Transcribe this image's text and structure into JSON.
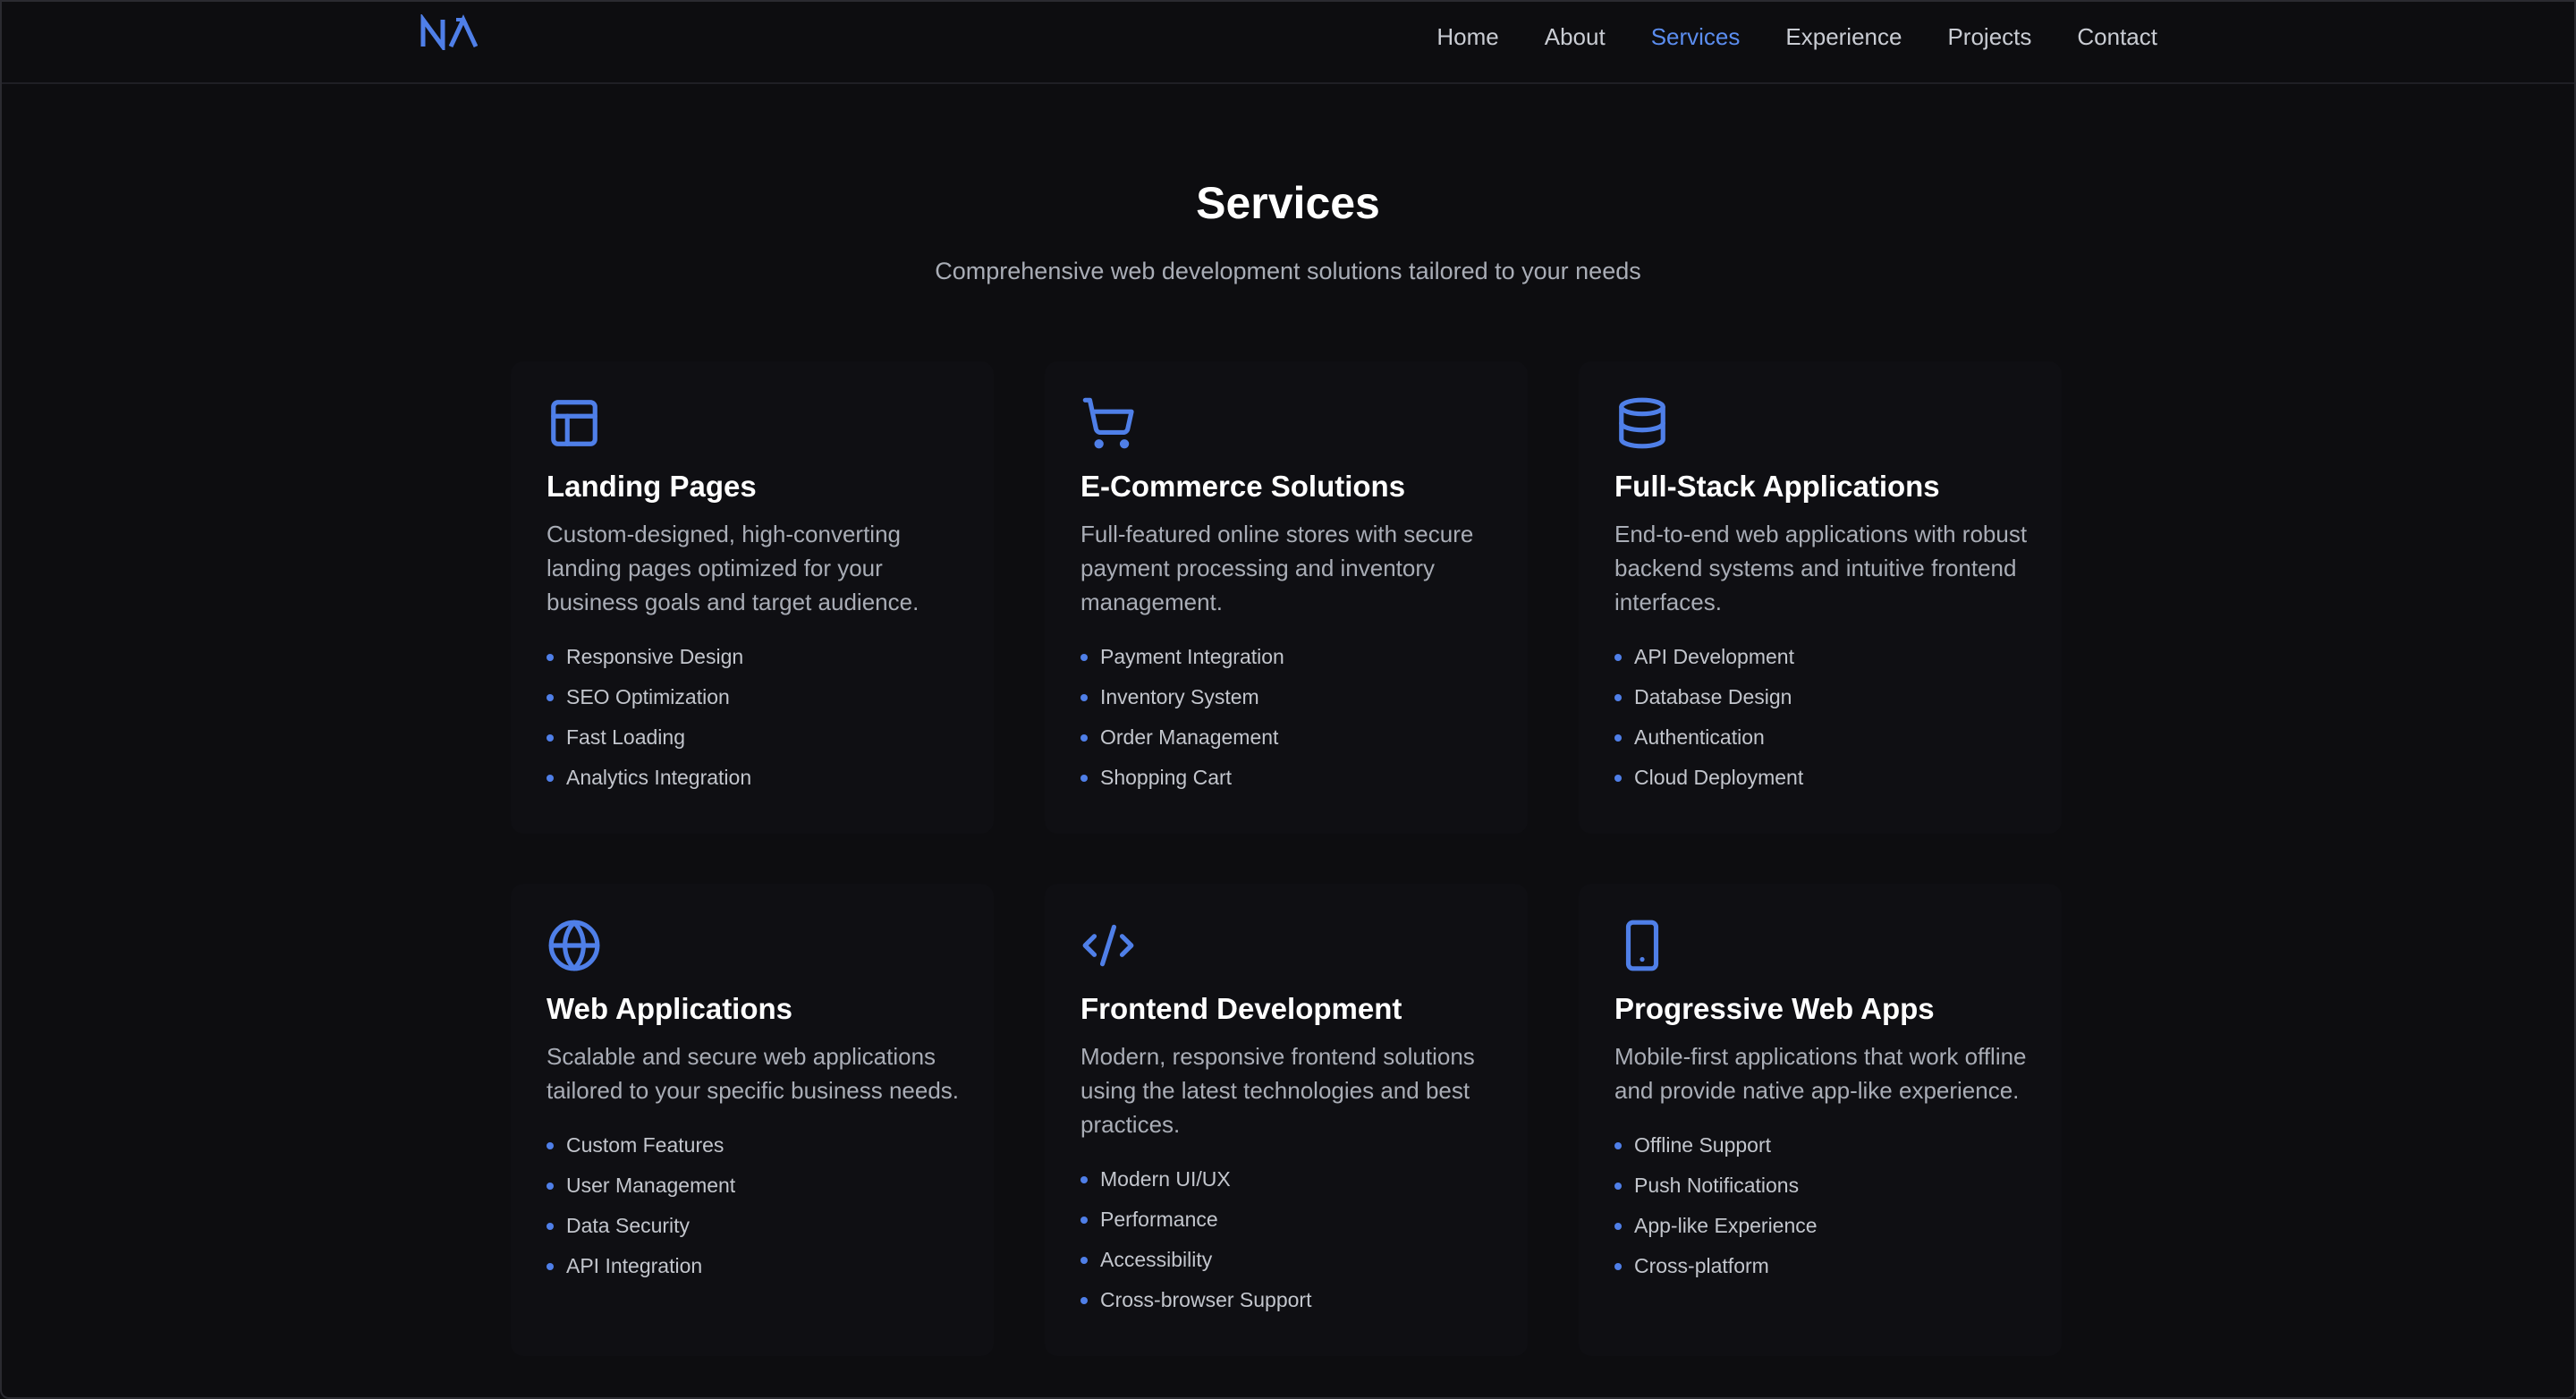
{
  "nav": {
    "logo_text": "NΛ",
    "links": [
      {
        "label": "Home",
        "active": false
      },
      {
        "label": "About",
        "active": false
      },
      {
        "label": "Services",
        "active": true
      },
      {
        "label": "Experience",
        "active": false
      },
      {
        "label": "Projects",
        "active": false
      },
      {
        "label": "Contact",
        "active": false
      }
    ]
  },
  "header": {
    "title": "Services",
    "subtitle": "Comprehensive web development solutions tailored to your needs"
  },
  "colors": {
    "accent": "#4f7fe8",
    "active_nav": "#5b8def",
    "background": "#0d0d10",
    "card_background": "#0f0f13"
  },
  "services": [
    {
      "icon": "layout-icon",
      "title": "Landing Pages",
      "description": "Custom-designed, high-converting landing pages optimized for your business goals and target audience.",
      "features": [
        "Responsive Design",
        "SEO Optimization",
        "Fast Loading",
        "Analytics Integration"
      ]
    },
    {
      "icon": "shopping-cart-icon",
      "title": "E-Commerce Solutions",
      "description": "Full-featured online stores with secure payment processing and inventory management.",
      "features": [
        "Payment Integration",
        "Inventory System",
        "Order Management",
        "Shopping Cart"
      ]
    },
    {
      "icon": "database-icon",
      "title": "Full-Stack Applications",
      "description": "End-to-end web applications with robust backend systems and intuitive frontend interfaces.",
      "features": [
        "API Development",
        "Database Design",
        "Authentication",
        "Cloud Deployment"
      ]
    },
    {
      "icon": "globe-icon",
      "title": "Web Applications",
      "description": "Scalable and secure web applications tailored to your specific business needs.",
      "features": [
        "Custom Features",
        "User Management",
        "Data Security",
        "API Integration"
      ]
    },
    {
      "icon": "code-icon",
      "title": "Frontend Development",
      "description": "Modern, responsive frontend solutions using the latest technologies and best practices.",
      "features": [
        "Modern UI/UX",
        "Performance",
        "Accessibility",
        "Cross-browser Support"
      ]
    },
    {
      "icon": "tablet-icon",
      "title": "Progressive Web Apps",
      "description": "Mobile-first applications that work offline and provide native app-like experience.",
      "features": [
        "Offline Support",
        "Push Notifications",
        "App-like Experience",
        "Cross-platform"
      ]
    }
  ]
}
